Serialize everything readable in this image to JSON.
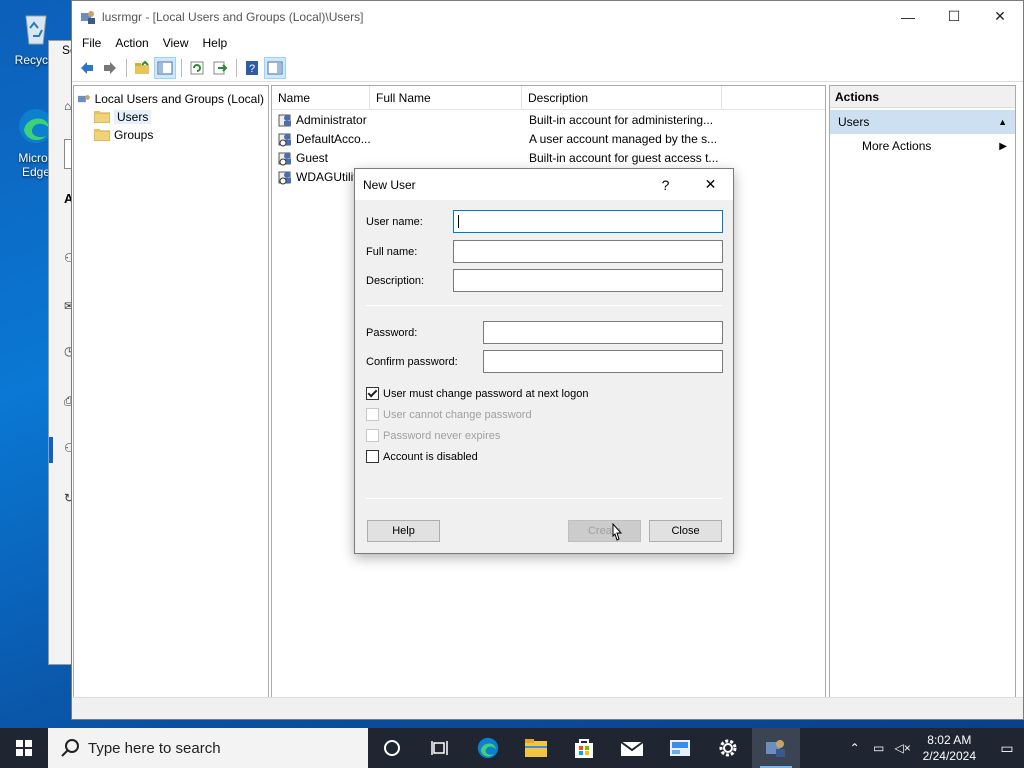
{
  "desktop": {
    "icons": [
      {
        "label": "Recycle",
        "icon": "recycle-bin-icon"
      },
      {
        "label": "Micros\nEdge",
        "icon": "edge-icon"
      }
    ],
    "bg_window_fragments": [
      "Se",
      "A"
    ]
  },
  "window": {
    "title": "lusrmgr - [Local Users and Groups (Local)\\Users]",
    "menu": [
      "File",
      "Action",
      "View",
      "Help"
    ],
    "toolbar": [
      "back-icon",
      "forward-icon",
      "up-folder-icon",
      "show-tree-icon",
      "refresh-icon",
      "export-icon",
      "help-icon",
      "show-actions-icon"
    ]
  },
  "tree": {
    "root": "Local Users and Groups (Local)",
    "items": [
      {
        "label": "Users",
        "selected": true
      },
      {
        "label": "Groups",
        "selected": false
      }
    ]
  },
  "list": {
    "columns": [
      "Name",
      "Full Name",
      "Description"
    ],
    "rows": [
      {
        "name": "Administrator",
        "full_name": "",
        "description": "Built-in account for administering..."
      },
      {
        "name": "DefaultAcco...",
        "full_name": "",
        "description": "A user account managed by the s..."
      },
      {
        "name": "Guest",
        "full_name": "",
        "description": "Built-in account for guest access t..."
      },
      {
        "name": "WDAGUtilit",
        "full_name": "",
        "description": ""
      }
    ]
  },
  "actions": {
    "header": "Actions",
    "section": "Users",
    "more": "More Actions"
  },
  "dialog": {
    "title": "New User",
    "help_glyph": "?",
    "close_glyph": "✕",
    "fields": {
      "username_label": "User name:",
      "username_value": "",
      "fullname_label": "Full name:",
      "fullname_value": "",
      "description_label": "Description:",
      "description_value": "",
      "password_label": "Password:",
      "confirm_label": "Confirm password:"
    },
    "checkboxes": [
      {
        "label": "User must change password at next logon",
        "checked": true,
        "enabled": true
      },
      {
        "label": "User cannot change password",
        "checked": false,
        "enabled": false
      },
      {
        "label": "Password never expires",
        "checked": false,
        "enabled": false
      },
      {
        "label": "Account is disabled",
        "checked": false,
        "enabled": true
      }
    ],
    "buttons": {
      "help": "Help",
      "create": "Create",
      "close": "Close"
    }
  },
  "taskbar": {
    "search_placeholder": "Type here to search",
    "apps": [
      "cortana-icon",
      "task-view-icon",
      "edge-icon",
      "file-explorer-icon",
      "store-icon",
      "mail-icon",
      "server-manager-icon",
      "settings-icon",
      "lusrmgr-icon"
    ],
    "time": "8:02 AM",
    "date": "2/24/2024"
  },
  "colors": {
    "accent": "#0078d7",
    "taskbar": "#1f2632",
    "selection": "#cde0f2"
  }
}
